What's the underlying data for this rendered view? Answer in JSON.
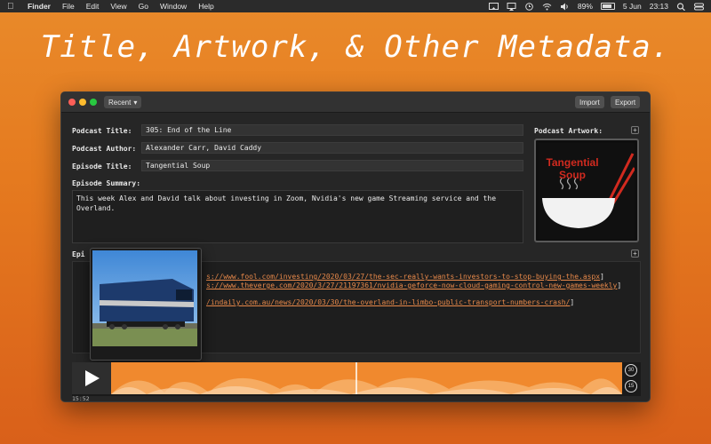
{
  "menubar": {
    "apple_icon": "apple-icon",
    "app_name": "Finder",
    "menus": [
      "File",
      "Edit",
      "View",
      "Go",
      "Window",
      "Help"
    ],
    "battery": "89%",
    "date": "5 Jun",
    "time": "23:13"
  },
  "headline": "Title, Artwork, & Other Metadata.",
  "toolbar": {
    "recent_label": "Recent",
    "import_label": "Import",
    "export_label": "Export"
  },
  "form": {
    "podcast_title_label": "Podcast Title:",
    "podcast_title_value": "305: End of the Line",
    "podcast_author_label": "Podcast Author:",
    "podcast_author_value": "Alexander Carr, David Caddy",
    "episode_title_label": "Episode Title:",
    "episode_title_value": "Tangential Soup",
    "episode_summary_label": "Episode Summary:",
    "episode_summary_value": "This week Alex and David talk about investing in Zoom, Nvidia's new game Streaming service and the Overland.",
    "podcast_artwork_label": "Podcast Artwork:",
    "episode_notes_label_partial": "Epi"
  },
  "artwork": {
    "line1": "Tangential",
    "line2": "Soup",
    "accent": "#d12a1f"
  },
  "notes": {
    "line1_prefix": "s://www.fool.com/investing/2020/03/27/the-sec-really-wants-investors-to-stop-buying-the.aspx",
    "line1_suffix": "]",
    "line2_prefix": "s://www.theverge.com/2020/3/27/21197361/nvidia-geforce-now-cloud-gaming-control-new-games-weekly",
    "line2_suffix": "]",
    "line3_prefix": "/indaily.com.au/news/2020/03/30/the-overland-in-limbo-public-transport-numbers-crash/",
    "line3_suffix": "]"
  },
  "player": {
    "time": "15:52",
    "skip_forward": "30",
    "skip_back": "15",
    "progress": 0.48,
    "accent": "#f0892e"
  }
}
